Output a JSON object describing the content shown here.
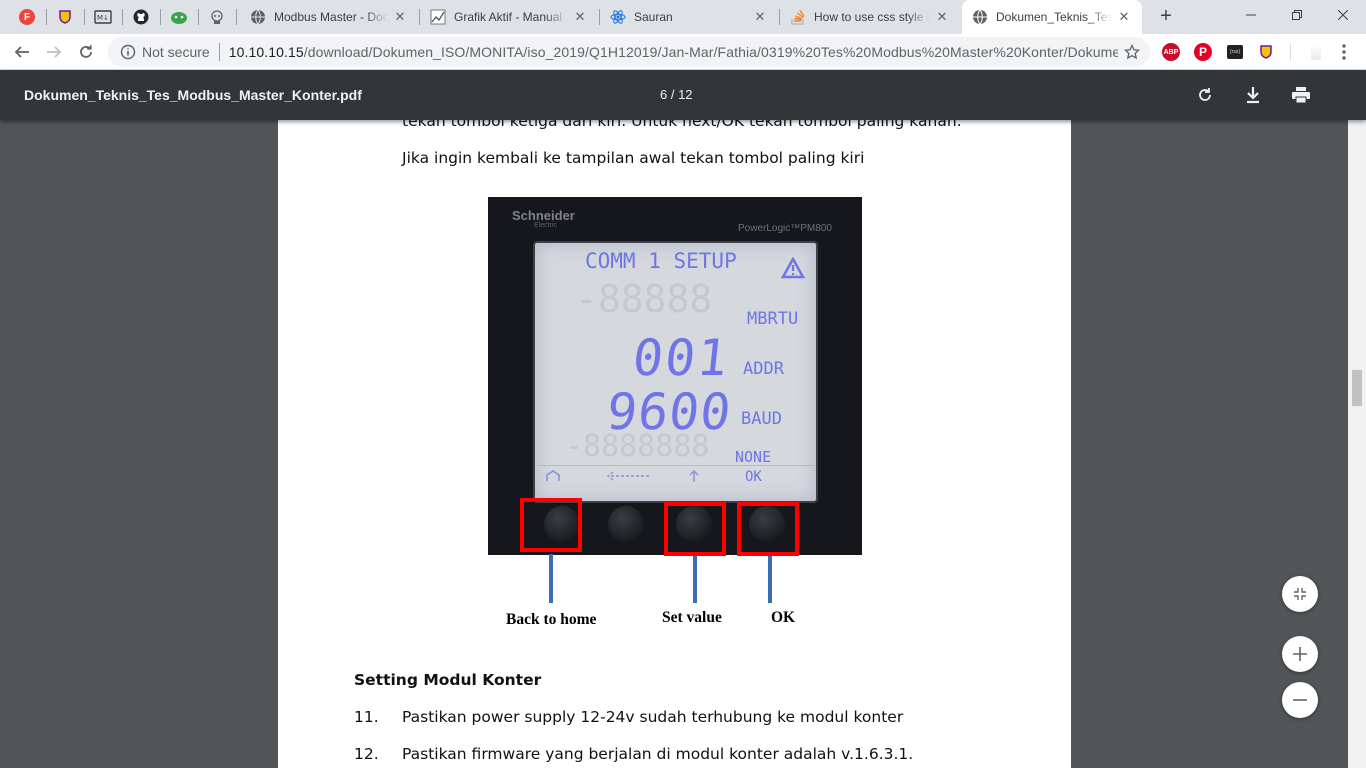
{
  "browser": {
    "tabs": [
      {
        "title": "Modbus Master - Doc",
        "icon": "globe-icon"
      },
      {
        "title": "Grafik Aktif - Manual",
        "icon": "chart-icon"
      },
      {
        "title": "Sauran",
        "icon": "react-icon"
      },
      {
        "title": "How to use css style in",
        "icon": "stackoverflow-icon"
      },
      {
        "title": "Dokumen_Teknis_Tes_",
        "icon": "globe-icon"
      }
    ],
    "close_glyph": "✕",
    "new_tab_glyph": "+",
    "omnibox": {
      "security_label": "Not secure",
      "url_host": "10.10.10.15",
      "url_path": "/download/Dokumen_ISO/MONITA/iso_2019/Q1H12019/Jan-Mar/Fathia/0319%20Tes%20Modbus%20Master%20Konter/Dokume..."
    },
    "extensions": [
      {
        "name": "adblock-plus-icon",
        "label": "ABP",
        "color": "#c70d2c"
      },
      {
        "name": "pinterest-icon",
        "label": "P",
        "color": "#e60023"
      },
      {
        "name": "ext-dark-icon",
        "label": "{rss}",
        "color": "#222222"
      }
    ]
  },
  "pdf": {
    "file_name": "Dokumen_Teknis_Tes_Modbus_Master_Konter.pdf",
    "page_indicator": "6 / 12",
    "lines": {
      "cut_top": "tekan tombol ketiga dari kiri. Untuk next/OK tekan tombol paling kanan.",
      "back_instruction": "Jika ingin kembali ke tampilan awal tekan tombol paling kiri",
      "section_heading": "Setting Modul Konter",
      "item11_num": "11.",
      "item11_text": "Pastikan power supply 12-24v sudah terhubung ke modul konter",
      "item12_num": "12.",
      "item12_text": "Pastikan firmware yang berjalan di modul konter adalah v.1.6.3.1."
    },
    "device_photo": {
      "brand": "Schneider",
      "brand_sub": "Electric",
      "model": "PowerLogic™PM800",
      "lcd_header": "COMM 1 SETUP",
      "lcd_mode": "MBRTU",
      "lcd_addr_value": "001",
      "lcd_addr_label": "ADDR",
      "lcd_baud_value": "9600",
      "lcd_baud_label": "BAUD",
      "lcd_parity_label": "NONE",
      "lcd_ok_label": "OK",
      "ghost_row1": "-88888",
      "ghost_row4": "-8888888"
    },
    "captions": {
      "back": "Back to home",
      "set": "Set value",
      "ok": "OK"
    }
  },
  "colors": {
    "annotation_box": "#ff0000",
    "leader_line": "#3a6db4",
    "lcd_segment": "#6f74e6"
  }
}
